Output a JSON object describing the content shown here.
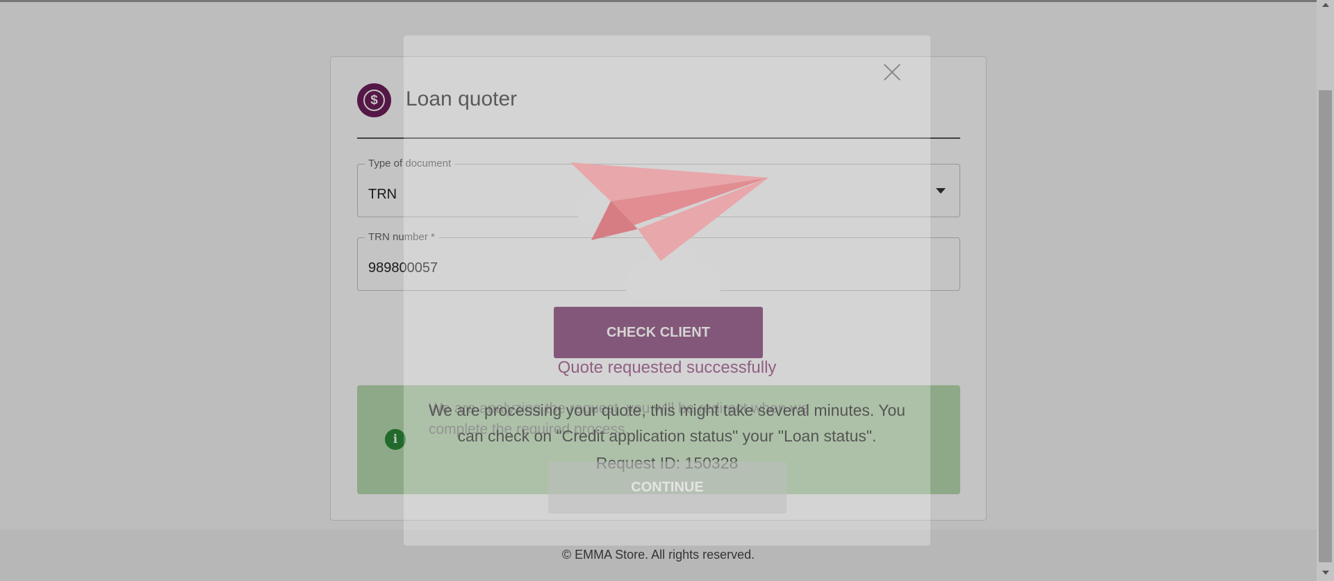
{
  "colors": {
    "brand": "#6e1f5c",
    "success_background": "#b9dcb0",
    "info_icon": "#2c8b3a",
    "paper_plane": "#e38d92"
  },
  "quoter": {
    "title": "Loan quoter",
    "icon": "dollar-coin-icon",
    "document_type": {
      "label": "Type of document",
      "value": "TRN"
    },
    "trn_number": {
      "label": "TRN number *",
      "value": "989800057"
    },
    "check_client_label": "CHECK CLIENT",
    "alert": {
      "icon": "info-icon",
      "text": "We are analyzing the request, you will be redirect when we complete the required process."
    }
  },
  "modal": {
    "close_icon": "close-icon",
    "illustration": "paper-plane-icon",
    "status": "Quote requested successfully",
    "message": "We are processing your quote, this might take several minutes. You can check on \"Credit application status\" your \"Loan status\".",
    "request_id": "Request ID: 150328",
    "continue_label": "CONTINUE"
  },
  "footer": {
    "copyright": "© EMMA Store. All rights reserved."
  }
}
